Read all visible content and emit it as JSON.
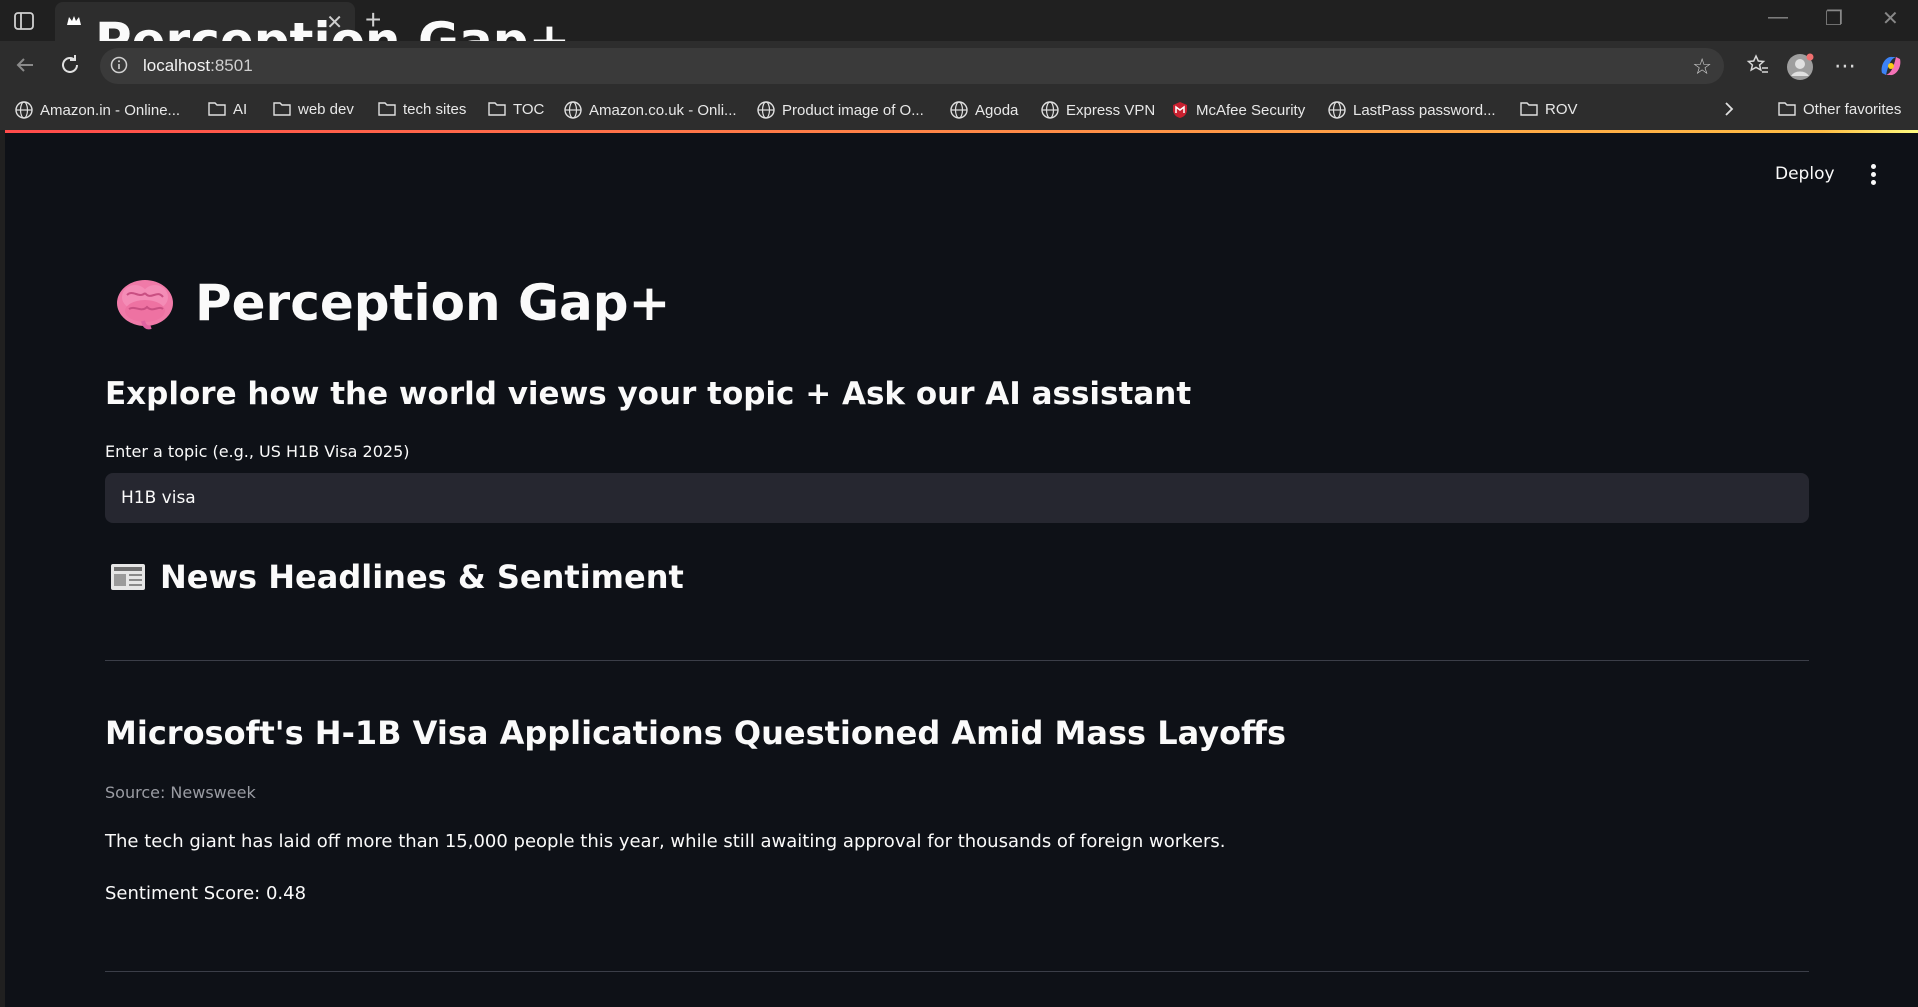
{
  "browser": {
    "tab_title": "Perception Gap+",
    "new_tab_label": "+",
    "url_host": "localhost",
    "url_port": ":8501",
    "bookmarks": [
      {
        "label": "Amazon.in - Online...",
        "icon": "globe-icon"
      },
      {
        "label": "AI",
        "icon": "folder-icon"
      },
      {
        "label": "web dev",
        "icon": "folder-icon"
      },
      {
        "label": "tech sites",
        "icon": "folder-icon"
      },
      {
        "label": "TOC",
        "icon": "folder-icon"
      },
      {
        "label": "Amazon.co.uk - Onli...",
        "icon": "globe-icon"
      },
      {
        "label": "Product image of O...",
        "icon": "globe-icon"
      },
      {
        "label": "Agoda",
        "icon": "globe-icon"
      },
      {
        "label": "Express VPN",
        "icon": "globe-icon"
      },
      {
        "label": "McAfee Security",
        "icon": "mcafee-shield-icon"
      },
      {
        "label": "LastPass password...",
        "icon": "globe-icon"
      },
      {
        "label": "ROV",
        "icon": "folder-icon"
      }
    ],
    "other_favorites": "Other favorites"
  },
  "app": {
    "deploy_label": "Deploy",
    "title": "Perception Gap+",
    "subtitle": "Explore how the world views your topic + Ask our AI assistant",
    "topic_input": {
      "label": "Enter a topic (e.g., US H1B Visa 2025)",
      "value": "H1B visa"
    },
    "news_section_heading": "News Headlines & Sentiment",
    "articles": [
      {
        "headline": "Microsoft's H-1B Visa Applications Questioned Amid Mass Layoffs",
        "source": "Source: Newsweek",
        "description": "The tech giant has laid off more than 15,000 people this year, while still awaiting approval for thousands of foreign workers.",
        "sentiment": "Sentiment Score: 0.48"
      }
    ]
  },
  "colors": {
    "app_background": "#0e1117",
    "input_background": "#262730",
    "accent_gradient_start": "#ff4b4b",
    "accent_gradient_end": "#fffd80",
    "browser_chrome": "#2d2d2d"
  }
}
